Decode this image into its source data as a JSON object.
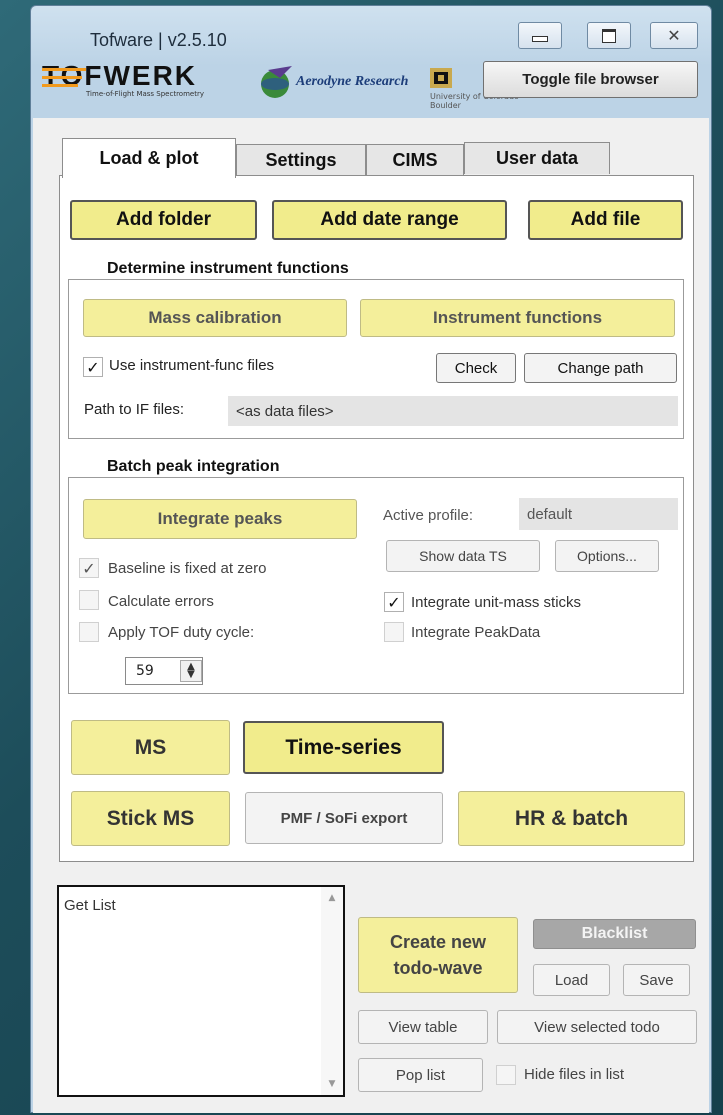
{
  "window": {
    "title": "Tofware | v2.5.10",
    "controls": {
      "minimize_icon": "minimize-icon",
      "maximize_icon": "maximize-icon",
      "close_icon": "close-icon"
    }
  },
  "logos": {
    "tofwerk": "TOFWERK",
    "tofwerk_sub": "Time-of-Flight Mass Spectrometry",
    "aerodyne": "Aerodyne Research",
    "cu_line1": "University of Colorado",
    "cu_line2": "Boulder"
  },
  "toggle_file_browser": "Toggle file browser",
  "tabs": [
    "Load & plot",
    "Settings",
    "CIMS",
    "User data"
  ],
  "top_buttons": {
    "add_folder": "Add folder",
    "add_date_range": "Add date range",
    "add_file": "Add file"
  },
  "instrument": {
    "group_title": "Determine instrument functions",
    "mass_calibration": "Mass calibration",
    "instrument_functions": "Instrument functions",
    "use_if_files": {
      "label": "Use instrument-func files",
      "checked": true
    },
    "check": "Check",
    "change_path": "Change path",
    "path_label": "Path to IF files:",
    "path_value": "<as data files>"
  },
  "batch": {
    "group_title": "Batch peak integration",
    "integrate_peaks": "Integrate peaks",
    "active_profile_label": "Active profile:",
    "active_profile_value": "default",
    "show_data_ts": "Show data TS",
    "options": "Options...",
    "baseline_fixed": {
      "label": "Baseline is fixed at zero",
      "checked": true
    },
    "calculate_errors": {
      "label": "Calculate errors",
      "checked": false
    },
    "apply_tof_duty": {
      "label": "Apply TOF duty cycle:",
      "checked": false
    },
    "integrate_unit_mass": {
      "label": "Integrate unit-mass sticks",
      "checked": true
    },
    "integrate_peakdata": {
      "label": "Integrate PeakData",
      "checked": false
    },
    "duty_value": "59"
  },
  "plot_buttons": {
    "ms": "MS",
    "time_series": "Time-series",
    "stick_ms": "Stick MS",
    "pmf_export": "PMF / SoFi export",
    "hr_batch": "HR & batch"
  },
  "get_list": {
    "text": "Get List"
  },
  "todo": {
    "create_line1": "Create new",
    "create_line2": "todo-wave",
    "blacklist": "Blacklist",
    "load": "Load",
    "save": "Save",
    "view_table": "View table",
    "view_selected_todo": "View selected todo",
    "pop_list": "Pop list",
    "hide_files": {
      "label": "Hide files in list",
      "checked": false
    }
  },
  "check_glyph": "✓"
}
